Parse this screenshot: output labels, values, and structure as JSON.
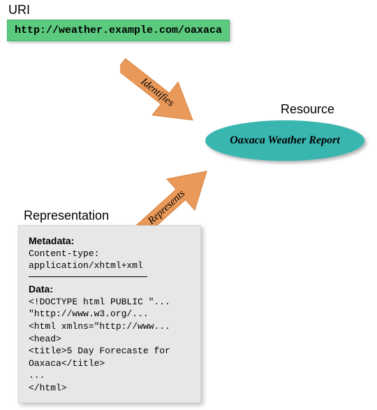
{
  "uri": {
    "label": "URI",
    "value": "http://weather.example.com/oaxaca"
  },
  "resource": {
    "label": "Resource",
    "name": "Oaxaca Weather Report"
  },
  "representation": {
    "label": "Representation",
    "metadata_label": "Metadata:",
    "metadata_lines": [
      "Content-type:",
      "application/xhtml+xml"
    ],
    "data_label": "Data:",
    "data_lines": [
      "<!DOCTYPE html PUBLIC \"...",
      "   \"http://www.w3.org/...",
      "<html xmlns=\"http://www...",
      "<head>",
      "<title>5 Day Forecaste for",
      "Oaxaca</title>",
      "...",
      "</html>"
    ]
  },
  "arrows": {
    "identifies": "Identifies",
    "represents": "Represents"
  },
  "colors": {
    "uri_box": "#5bca7e",
    "resource_ellipse": "#3ab6b0",
    "arrow": "#e9995a",
    "rep_box": "#e7e7e7"
  }
}
